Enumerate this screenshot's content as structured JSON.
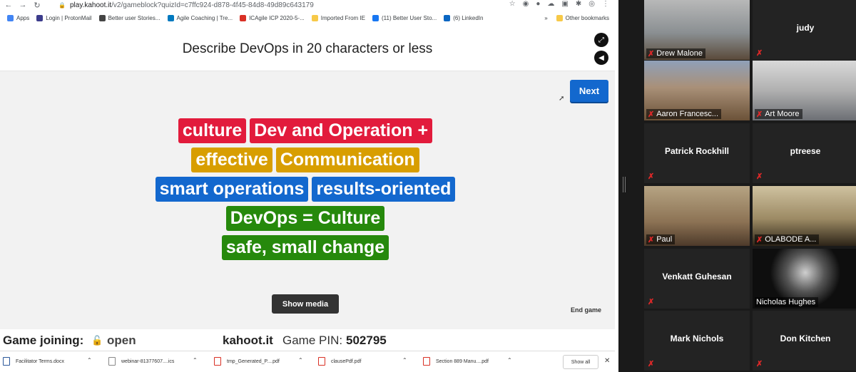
{
  "browser": {
    "url_host": "play.kahoot.it",
    "url_path": "/v2/gameblock?quizId=c7ffc924-d878-4f45-84d8-49d89c643179",
    "bookmarks": [
      {
        "label": "Apps",
        "color": "#4285f4"
      },
      {
        "label": "Login | ProtonMail",
        "color": "#3c3c8c"
      },
      {
        "label": "Better user Stories...",
        "color": "#444444"
      },
      {
        "label": "Agile Coaching | Tre...",
        "color": "#0079bf"
      },
      {
        "label": "ICAgile ICP 2020-5-...",
        "color": "#d93025"
      },
      {
        "label": "Imported From IE",
        "color": "#f7c948"
      },
      {
        "label": "(11) Better User Sto...",
        "color": "#1877f2"
      },
      {
        "label": "(6) LinkedIn",
        "color": "#0a66c2"
      }
    ],
    "bookmarks_more": "»",
    "other_bookmarks": "Other bookmarks"
  },
  "kahoot": {
    "question": "Describe DevOps in 20 characters or less",
    "next_label": "Next",
    "show_media_label": "Show media",
    "end_game_label": "End game",
    "word_cloud": [
      [
        {
          "text": "culture",
          "color": "#e21b3c"
        },
        {
          "text": "Dev and Operation +",
          "color": "#e21b3c"
        }
      ],
      [
        {
          "text": "effective",
          "color": "#d89e00"
        },
        {
          "text": "Communication",
          "color": "#d89e00"
        }
      ],
      [
        {
          "text": "smart operations",
          "color": "#1368ce"
        },
        {
          "text": "results-oriented",
          "color": "#1368ce"
        }
      ],
      [
        {
          "text": "DevOps = Culture",
          "color": "#26890c"
        }
      ],
      [
        {
          "text": "safe, small change",
          "color": "#26890c"
        }
      ]
    ],
    "footer": {
      "joining_label": "Game joining:",
      "joining_status": "open",
      "site": "kahoot.it",
      "pin_label": "Game PIN:",
      "pin": "502795"
    }
  },
  "downloads": {
    "items": [
      {
        "name": "Facilitator Terms.docx",
        "color": "#2b579a"
      },
      {
        "name": "webinar-81377607....ics",
        "color": "#888888"
      },
      {
        "name": "tmp_Generated_P....pdf",
        "color": "#d93025"
      },
      {
        "name": "clausePdf.pdf",
        "color": "#d93025"
      },
      {
        "name": "Section 889 Manu....pdf",
        "color": "#d93025"
      }
    ],
    "show_all": "Show all"
  },
  "zoom": {
    "participants": [
      {
        "name": "Drew Malone",
        "video": true
      },
      {
        "name": "judy",
        "video": false
      },
      {
        "name": "Aaron Francesc...",
        "video": true,
        "active": true
      },
      {
        "name": "Art Moore",
        "video": true
      },
      {
        "name": "Patrick Rockhill",
        "video": false
      },
      {
        "name": "ptreese",
        "video": false
      },
      {
        "name": "Paul",
        "video": true
      },
      {
        "name": "OLABODE A...",
        "video": true
      },
      {
        "name": "Venkatt Guhesan",
        "video": false
      },
      {
        "name": "Nicholas Hughes",
        "video": true
      },
      {
        "name": "Mark Nichols",
        "video": false
      },
      {
        "name": "Don Kitchen",
        "video": false
      }
    ]
  }
}
